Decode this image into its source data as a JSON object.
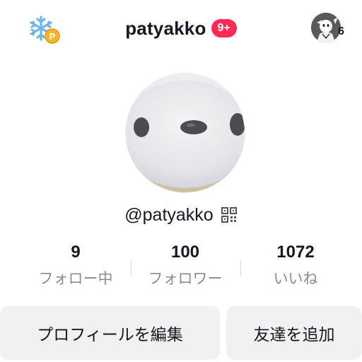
{
  "header": {
    "username_title": "patyakko",
    "notification_badge": "9+",
    "profile_visitors_count": "6"
  },
  "profile": {
    "handle": "@patyakko"
  },
  "stats": [
    {
      "value": "9",
      "label": "フォロー中"
    },
    {
      "value": "100",
      "label": "フォロワー"
    },
    {
      "value": "1072",
      "label": "いいね"
    }
  ],
  "actions": {
    "edit_profile": "プロフィールを編集",
    "add_friends": "友達を追加"
  },
  "icons": {
    "promo": "snowflake-coin-icon",
    "qr": "qr-code-icon"
  },
  "colors": {
    "badge": "#fe2c55",
    "text": "#161823",
    "muted": "#8a8b91",
    "button_bg": "#f1f1f2"
  }
}
